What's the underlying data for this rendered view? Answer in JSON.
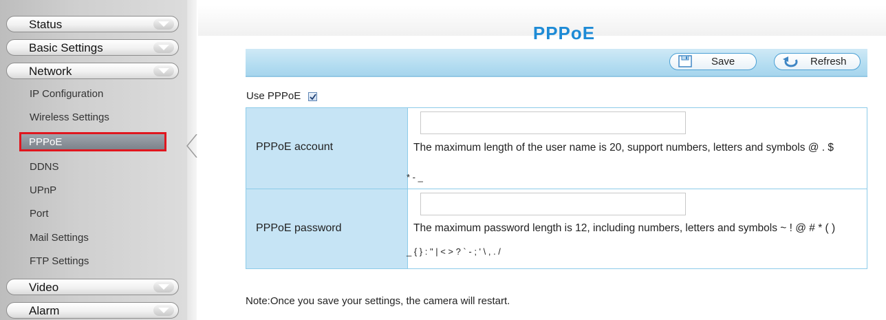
{
  "sidebar": {
    "menus": [
      {
        "label": "Status"
      },
      {
        "label": "Basic Settings"
      },
      {
        "label": "Network"
      },
      {
        "label": "Video"
      },
      {
        "label": "Alarm"
      }
    ],
    "network_items": [
      {
        "label": "IP Configuration"
      },
      {
        "label": "Wireless Settings"
      },
      {
        "label": "PPPoE"
      },
      {
        "label": "DDNS"
      },
      {
        "label": "UPnP"
      },
      {
        "label": "Port"
      },
      {
        "label": "Mail Settings"
      },
      {
        "label": "FTP Settings"
      }
    ]
  },
  "main": {
    "title": "PPPoE",
    "toolbar": {
      "save_label": "Save",
      "refresh_label": "Refresh"
    },
    "use_pppoe": {
      "label": "Use PPPoE",
      "checked": true
    },
    "fields": [
      {
        "label": "PPPoE account",
        "value": "",
        "hint_line1": "The maximum length of the user name is 20, support numbers, letters and symbols @ . $",
        "hint_line2": "* - _"
      },
      {
        "label": "PPPoE password",
        "value": "",
        "hint_line1": "The maximum password length is 12, including numbers, letters and symbols ~ ! @ # * ( )",
        "hint_line2": "_ { } : \" | < > ? ` - ; ' \\ , . /"
      }
    ],
    "note": "Note:Once you save your settings, the camera will restart."
  },
  "colors": {
    "accent": "#1e8bd6",
    "highlight_border": "#e0161e",
    "table_label_bg": "#c6e4f5"
  }
}
